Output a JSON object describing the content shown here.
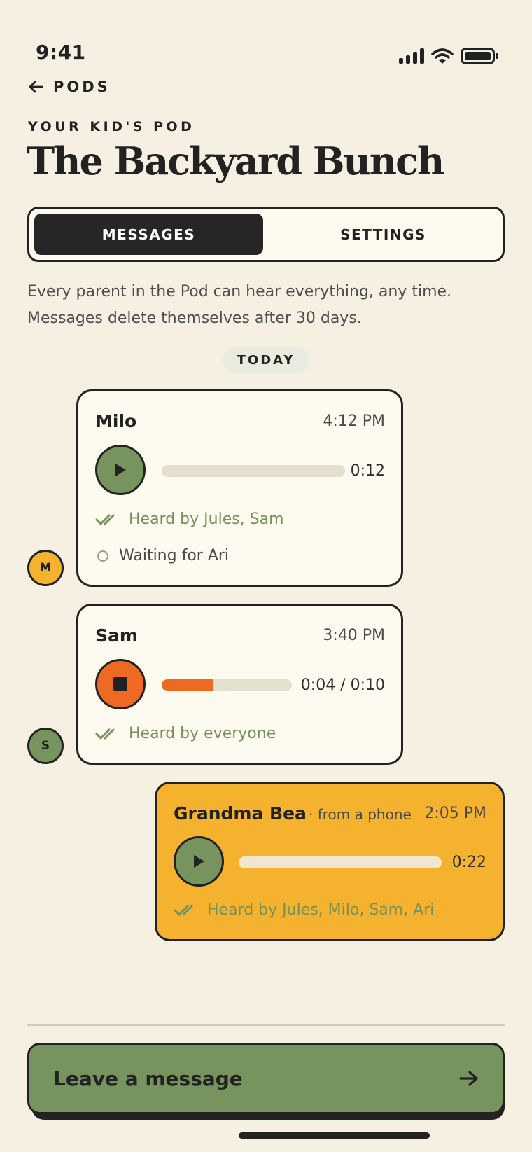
{
  "status_bar": {
    "time": "9:41"
  },
  "nav": {
    "back_label": "PODS"
  },
  "header": {
    "eyebrow": "YOUR KID'S POD",
    "title": "The Backyard Bunch"
  },
  "tabs": [
    {
      "label": "MESSAGES",
      "active": true
    },
    {
      "label": "SETTINGS",
      "active": false
    }
  ],
  "intro": "Every parent in the Pod can hear everything, any time. Messages delete themselves after 30 days.",
  "day_label": "TODAY",
  "messages": [
    {
      "sender": "Milo",
      "avatar_initial": "M",
      "avatar_color": "#F4B22E",
      "time": "4:12 PM",
      "state": "paused",
      "progress": 0,
      "duration": "0:12",
      "heard_by": "Heard by Jules, Sam",
      "waiting": "Waiting for Ari"
    },
    {
      "sender": "Sam",
      "avatar_initial": "S",
      "avatar_color": "#78945E",
      "time": "3:40 PM",
      "state": "playing",
      "progress": 0.4,
      "duration": "0:04 / 0:10",
      "heard_by": "Heard by everyone"
    },
    {
      "sender": "Grandma Bea",
      "source": "· from a phone",
      "time": "2:05 PM",
      "state": "paused",
      "progress": 0,
      "duration": "0:22",
      "heard_by": "Heard by Jules, Milo, Sam, Ari",
      "own": true
    }
  ],
  "cta": {
    "label": "Leave a message"
  },
  "colors": {
    "background": "#F5F0E1",
    "ink": "#222222",
    "green": "#78945E",
    "orange": "#EE6A22",
    "yellow": "#F4B22E",
    "card": "#FDFAF0"
  }
}
